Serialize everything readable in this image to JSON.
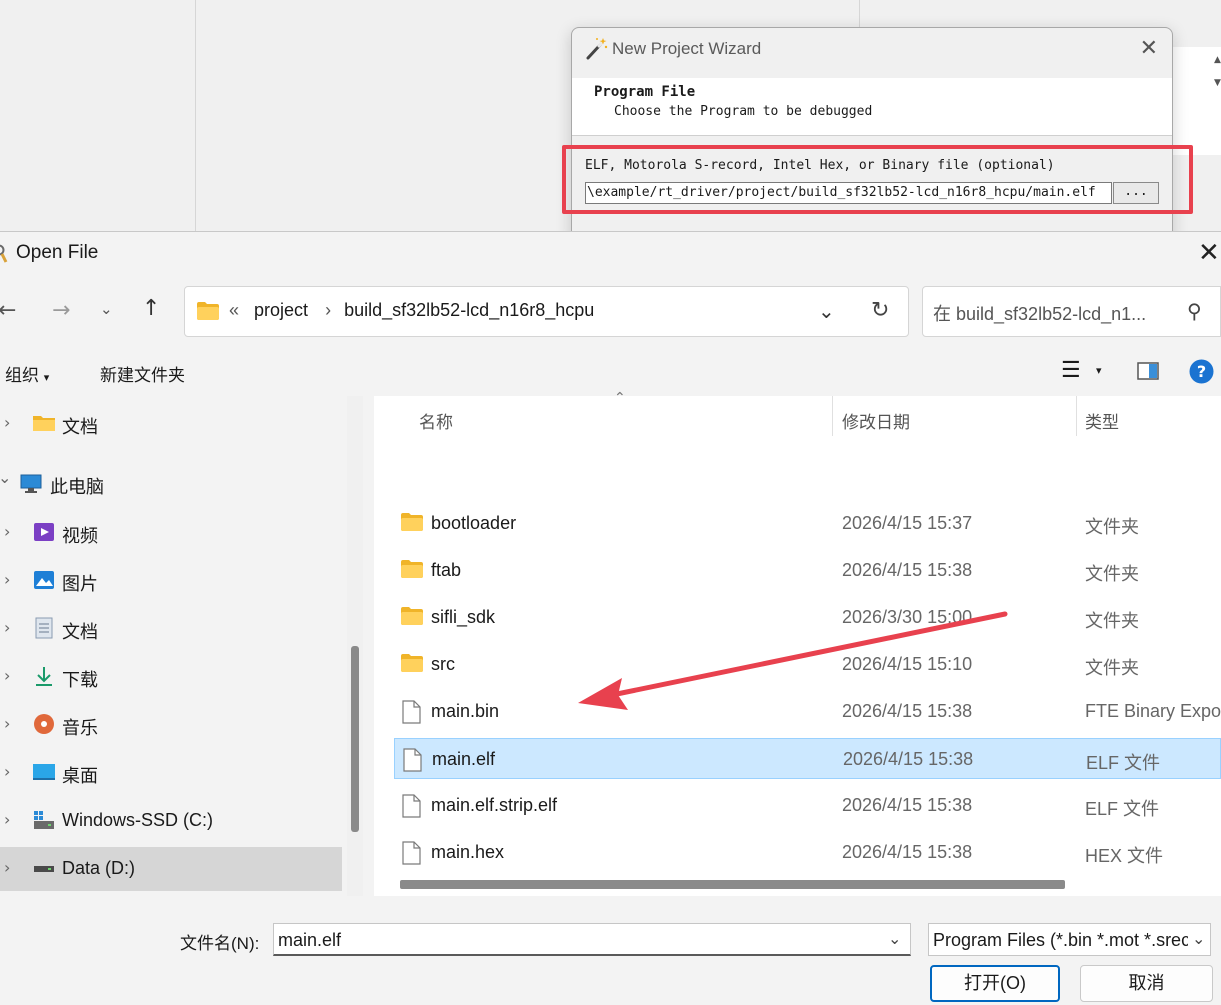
{
  "wizard": {
    "title": "New Project Wizard",
    "heading": "Program File",
    "subheading": "Choose the Program to be debugged",
    "field_label": "ELF, Motorola S-record, Intel Hex, or Binary file (optional)",
    "field_value": "\\example/rt_driver/project/build_sf32lb52-lcd_n16r8_hcpu/main.elf",
    "browse_label": "..."
  },
  "dialog": {
    "title": "Open File",
    "address": {
      "overflow": "«",
      "segments": [
        "project",
        "build_sf32lb52-lcd_n16r8_hcpu"
      ]
    },
    "search_placeholder": "在 build_sf32lb52-lcd_n1...",
    "toolbar": {
      "organize": "组织",
      "new_folder": "新建文件夹"
    },
    "nav_items": [
      {
        "label": "文档",
        "icon": "folder-icon",
        "chevron": "›"
      },
      {
        "label": "此电脑",
        "icon": "computer-icon",
        "chevron": "⌄"
      },
      {
        "label": "视频",
        "icon": "video-icon",
        "chevron": "›"
      },
      {
        "label": "图片",
        "icon": "pictures-icon",
        "chevron": "›"
      },
      {
        "label": "文档",
        "icon": "documents-icon",
        "chevron": "›"
      },
      {
        "label": "下载",
        "icon": "download-icon",
        "chevron": "›"
      },
      {
        "label": "音乐",
        "icon": "music-icon",
        "chevron": "›"
      },
      {
        "label": "桌面",
        "icon": "desktop-icon",
        "chevron": "›"
      },
      {
        "label": "Windows-SSD (C:)",
        "icon": "drive-c-icon",
        "chevron": "›"
      },
      {
        "label": "Data (D:)",
        "icon": "drive-d-icon",
        "chevron": "›"
      }
    ],
    "columns": {
      "name": "名称",
      "date": "修改日期",
      "type": "类型"
    },
    "files": [
      {
        "name": "bootloader",
        "date": "2026/4/15 15:37",
        "type": "文件夹",
        "kind": "folder"
      },
      {
        "name": "ftab",
        "date": "2026/4/15 15:38",
        "type": "文件夹",
        "kind": "folder"
      },
      {
        "name": "sifli_sdk",
        "date": "2026/3/30 15:00",
        "type": "文件夹",
        "kind": "folder"
      },
      {
        "name": "src",
        "date": "2026/4/15 15:10",
        "type": "文件夹",
        "kind": "folder"
      },
      {
        "name": "main.bin",
        "date": "2026/4/15 15:38",
        "type": "FTE Binary Expo",
        "kind": "file"
      },
      {
        "name": "main.elf",
        "date": "2026/4/15 15:38",
        "type": "ELF 文件",
        "kind": "file"
      },
      {
        "name": "main.elf.strip.elf",
        "date": "2026/4/15 15:38",
        "type": "ELF 文件",
        "kind": "file"
      },
      {
        "name": "main.hex",
        "date": "2026/4/15 15:38",
        "type": "HEX 文件",
        "kind": "file"
      }
    ],
    "filename_label": "文件名(N):",
    "filename_value": "main.elf",
    "filetype_value": "Program Files (*.bin *.mot *.srec",
    "open_button": "打开(O)",
    "cancel_button": "取消"
  },
  "colors": {
    "highlight_red": "#e8414e",
    "selection_blue": "#cce8ff",
    "accent": "#0067c0"
  }
}
